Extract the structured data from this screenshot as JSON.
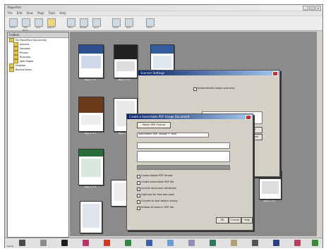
{
  "window": {
    "title": "PaperPort"
  },
  "menu": [
    "File",
    "Edit",
    "View",
    "Page",
    "Tools",
    "Help"
  ],
  "toolbar": [
    "Scan",
    "Get Photo",
    "Sort",
    "Search",
    "Find",
    "Rotate",
    "Save",
    "View",
    "Text",
    "Print"
  ],
  "folders": {
    "header": "Folders",
    "items": [
      "My PaperPort Documents",
      "Articles",
      "Samples",
      "Photos",
      "Business",
      "Web Pages",
      "Desktop",
      "Recent Items"
    ]
  },
  "thumbs": [
    "Page 1 of 3",
    "Page 1 of 2",
    "Page 1 of 4",
    "Page 1 of 1",
    "Page 1 of 2",
    "Page 1 of 3",
    "Page 1 of 1",
    "Page 1 of 2"
  ],
  "back_dialog": {
    "title": "Scanner Settings",
    "option": "Automatically begin scanning",
    "btn_ok": "OK",
    "btn_cancel": "Cancel"
  },
  "front_dialog": {
    "title": "Create a Searchable PDF Image Document",
    "tab": "Select PDF Format",
    "label_name": "Searchable PDF (Image + Text)",
    "options": [
      "Create Adobe PDF format",
      "Create searchable PDF file",
      "Include document attributes",
      "Optimize for fast web view",
      "Convert to text before saving",
      "Embed all fonts in PDF file"
    ],
    "btn_ok": "OK",
    "btn_cancel": "Cancel",
    "btn_help": "Help"
  },
  "status": "Ready",
  "colors": {
    "accent": "#0a246a",
    "desktop": "#8b8b8b"
  }
}
